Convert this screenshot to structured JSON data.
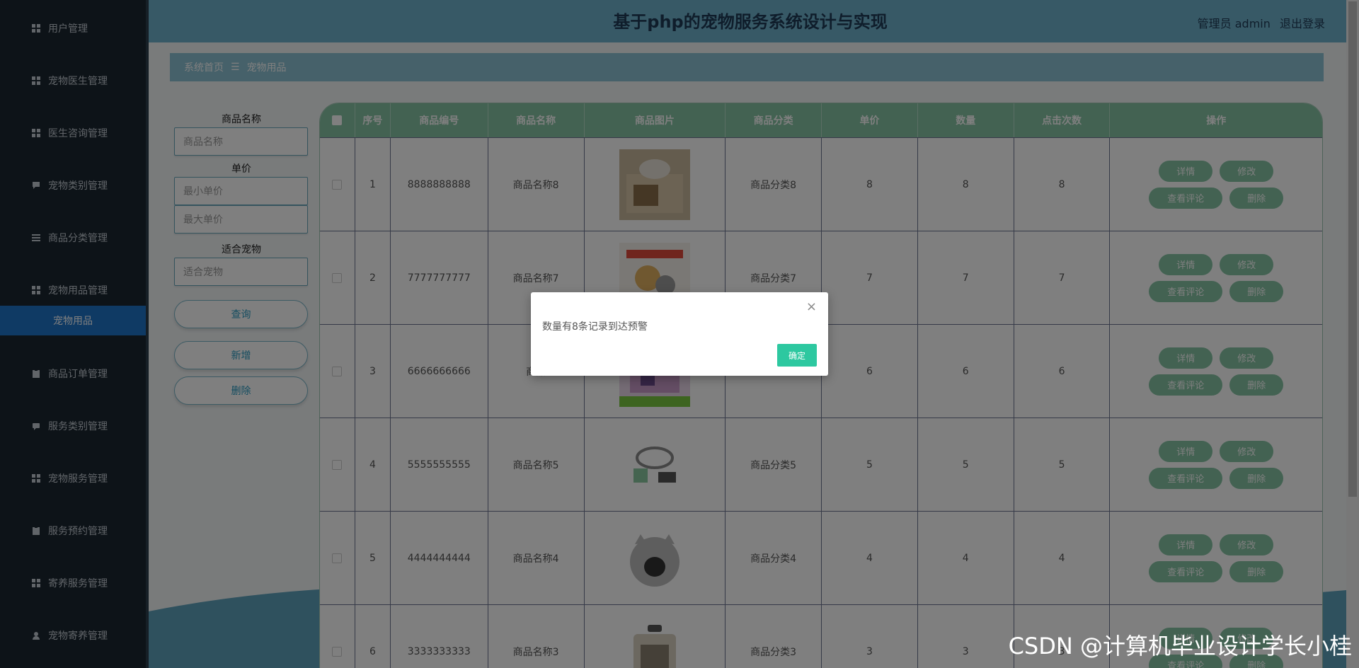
{
  "sidebar": {
    "items": [
      {
        "label": "用户管理",
        "icon": "grid-icon"
      },
      {
        "label": "宠物医生管理",
        "icon": "grid-icon"
      },
      {
        "label": "医生咨询管理",
        "icon": "grid-icon"
      },
      {
        "label": "宠物类别管理",
        "icon": "comment-icon"
      },
      {
        "label": "商品分类管理",
        "icon": "list-icon"
      },
      {
        "label": "宠物用品管理",
        "icon": "grid-icon"
      },
      {
        "label": "商品订单管理",
        "icon": "clipboard-icon"
      },
      {
        "label": "服务类别管理",
        "icon": "chat-icon"
      },
      {
        "label": "宠物服务管理",
        "icon": "grid-icon"
      },
      {
        "label": "服务预约管理",
        "icon": "clipboard-icon"
      },
      {
        "label": "寄养服务管理",
        "icon": "grid-icon"
      },
      {
        "label": "宠物寄养管理",
        "icon": "user-icon"
      }
    ],
    "active_sub": "宠物用品"
  },
  "header": {
    "title": "基于php的宠物服务系统设计与实现",
    "user": "管理员 admin",
    "logout": "退出登录"
  },
  "breadcrumb": {
    "home": "系统首页",
    "sep": "☰",
    "current": "宠物用品"
  },
  "search": {
    "name_label": "商品名称",
    "name_placeholder": "商品名称",
    "price_label": "单价",
    "min_placeholder": "最小单价",
    "max_placeholder": "最大单价",
    "pet_label": "适合宠物",
    "pet_placeholder": "适合宠物",
    "query": "查询",
    "add": "新增",
    "delete": "删除"
  },
  "table": {
    "headers": [
      "序号",
      "商品编号",
      "商品名称",
      "商品图片",
      "商品分类",
      "单价",
      "数量",
      "点击次数",
      "操作"
    ],
    "rows": [
      {
        "no": "1",
        "code": "8888888888",
        "name": "商品名称8",
        "category": "商品分类8",
        "price": "8",
        "qty": "8",
        "clicks": "8"
      },
      {
        "no": "2",
        "code": "7777777777",
        "name": "商品名称7",
        "category": "商品分类7",
        "price": "7",
        "qty": "7",
        "clicks": "7"
      },
      {
        "no": "3",
        "code": "6666666666",
        "name": "商品",
        "category": "",
        "price": "6",
        "qty": "6",
        "clicks": "6"
      },
      {
        "no": "4",
        "code": "5555555555",
        "name": "商品名称5",
        "category": "商品分类5",
        "price": "5",
        "qty": "5",
        "clicks": "5"
      },
      {
        "no": "5",
        "code": "4444444444",
        "name": "商品名称4",
        "category": "商品分类4",
        "price": "4",
        "qty": "4",
        "clicks": "4"
      },
      {
        "no": "6",
        "code": "3333333333",
        "name": "商品名称3",
        "category": "商品分类3",
        "price": "3",
        "qty": "3",
        "clicks": "3"
      }
    ],
    "actions": {
      "detail": "详情",
      "edit": "修改",
      "reviews": "查看评论",
      "delete": "删除"
    }
  },
  "modal": {
    "message": "数量有8条记录到达预警",
    "ok": "确定",
    "close": "×"
  },
  "watermark": "CSDN @计算机毕业设计学长小桂",
  "colors": {
    "sidebar_bg": "#1b2631",
    "active_sub": "#1f74c9",
    "header_bg": "#6fb2cc",
    "table_header": "#86c5a5",
    "ok_button": "#2dc8a0"
  }
}
